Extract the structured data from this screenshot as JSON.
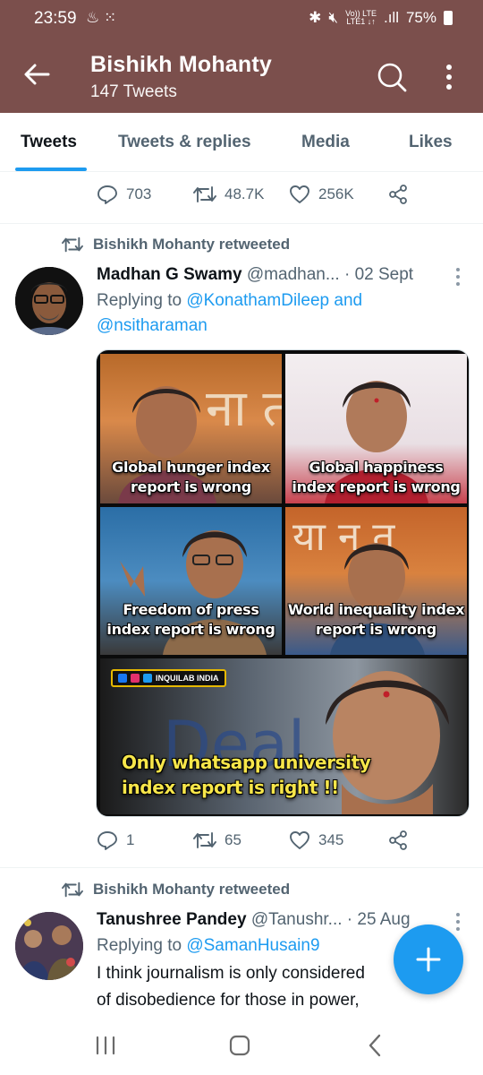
{
  "status_bar": {
    "time": "23:59",
    "left_icons": [
      "cleaner-icon",
      "grid-dots-icon"
    ],
    "network_label_top": "Vo)) LTE",
    "network_label_bottom": "LTE1 ↓↑",
    "battery": "75%"
  },
  "header": {
    "title": "Bishikh Mohanty",
    "subtitle": "147 Tweets",
    "background": "#7b4f4c"
  },
  "tabs": [
    {
      "label": "Tweets",
      "active": true
    },
    {
      "label": "Tweets & replies",
      "active": false
    },
    {
      "label": "Media",
      "active": false
    },
    {
      "label": "Likes",
      "active": false
    }
  ],
  "accent": "#1d9bf0",
  "previous_tweet": {
    "replies": "703",
    "retweets": "48.7K",
    "likes": "256K"
  },
  "tweets": [
    {
      "retweet_label": "Bishikh Mohanty retweeted",
      "name": "Madhan G Swamy",
      "handle": "@madhan...",
      "separator": "·",
      "date": "02 Sept",
      "replying_prefix": "Replying to",
      "replying_to_1": "@KonathamDileep",
      "replying_and": "and",
      "replying_to_2": "@nsitharaman",
      "media": {
        "panel_1": "Global hunger index report is wrong",
        "panel_2": "Global happiness index report is wrong",
        "panel_3": "Freedom of press index report is wrong",
        "panel_4": "World inequality index report is wrong",
        "panel_5": "Only whatsapp university index report is right !!",
        "watermark": "INQUILAB INDIA"
      },
      "replies": "1",
      "retweets": "65",
      "likes": "345"
    },
    {
      "retweet_label": "Bishikh Mohanty retweeted",
      "name": "Tanushree Pandey",
      "handle": "@Tanushr...",
      "separator": "·",
      "date": "25 Aug",
      "replying_prefix": "Replying to",
      "replying_to_1": "@SamanHusain9",
      "text_line_1": "I think journalism is only considered",
      "text_line_2": "of disobedience for those in power,"
    }
  ]
}
